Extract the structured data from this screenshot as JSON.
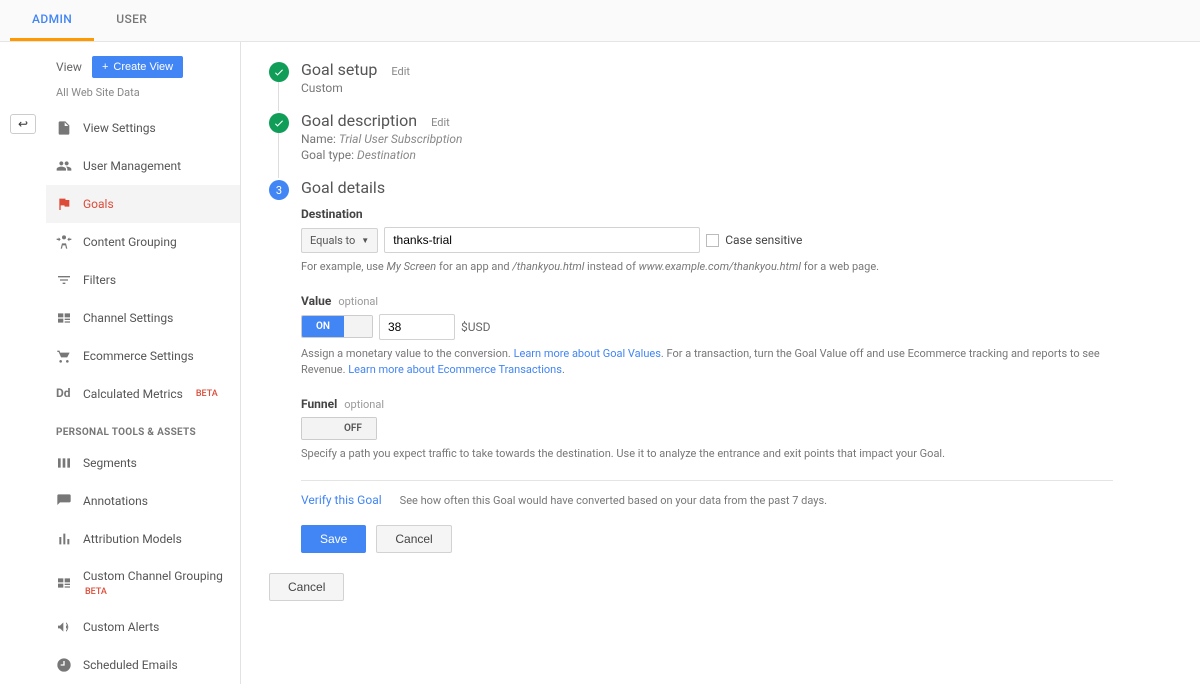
{
  "tabs": {
    "admin": "ADMIN",
    "user": "USER"
  },
  "view": {
    "label": "View",
    "create_btn": "Create View",
    "all_data": "All Web Site Data"
  },
  "nav": {
    "view_settings": "View Settings",
    "user_mgmt": "User Management",
    "goals": "Goals",
    "content_grouping": "Content Grouping",
    "filters": "Filters",
    "channel_settings": "Channel Settings",
    "ecommerce": "Ecommerce Settings",
    "calc_metrics": "Calculated Metrics",
    "calc_beta": "BETA",
    "section_personal": "PERSONAL TOOLS & ASSETS",
    "segments": "Segments",
    "annotations": "Annotations",
    "attribution": "Attribution Models",
    "custom_channel": "Custom Channel Grouping",
    "custom_channel_beta": "BETA",
    "custom_alerts": "Custom Alerts",
    "scheduled_emails": "Scheduled Emails"
  },
  "steps": {
    "setup": {
      "title": "Goal setup",
      "edit": "Edit",
      "sub": "Custom"
    },
    "desc": {
      "title": "Goal description",
      "edit": "Edit",
      "name_label": "Name:",
      "name_value": "Trial User Subscribption",
      "type_label": "Goal type:",
      "type_value": "Destination"
    },
    "details": {
      "title": "Goal details",
      "num": "3"
    }
  },
  "form": {
    "destination": {
      "header": "Destination",
      "match": "Equals to",
      "value": "thanks-trial",
      "case_label": "Case sensitive",
      "hint_pre": "For example, use ",
      "hint_ex1": "My Screen",
      "hint_mid1": " for an app and ",
      "hint_ex2": "/thankyou.html",
      "hint_mid2": " instead of ",
      "hint_ex3": "www.example.com/thankyou.html",
      "hint_post": " for a web page."
    },
    "value": {
      "header": "Value",
      "optional": "optional",
      "toggle_on": "ON",
      "amount": "38",
      "currency": "$USD",
      "hint_pre": "Assign a monetary value to the conversion. ",
      "link1": "Learn more about Goal Values",
      "hint_mid": ". For a transaction, turn the Goal Value off and use Ecommerce tracking and reports to see Revenue. ",
      "link2": "Learn more about Ecommerce Transactions",
      "hint_end": "."
    },
    "funnel": {
      "header": "Funnel",
      "optional": "optional",
      "toggle_off": "OFF",
      "hint": "Specify a path you expect traffic to take towards the destination. Use it to analyze the entrance and exit points that impact your Goal."
    },
    "verify": {
      "link": "Verify this Goal",
      "text": "See how often this Goal would have converted based on your data from the past 7 days."
    },
    "save": "Save",
    "cancel": "Cancel",
    "outer_cancel": "Cancel"
  }
}
